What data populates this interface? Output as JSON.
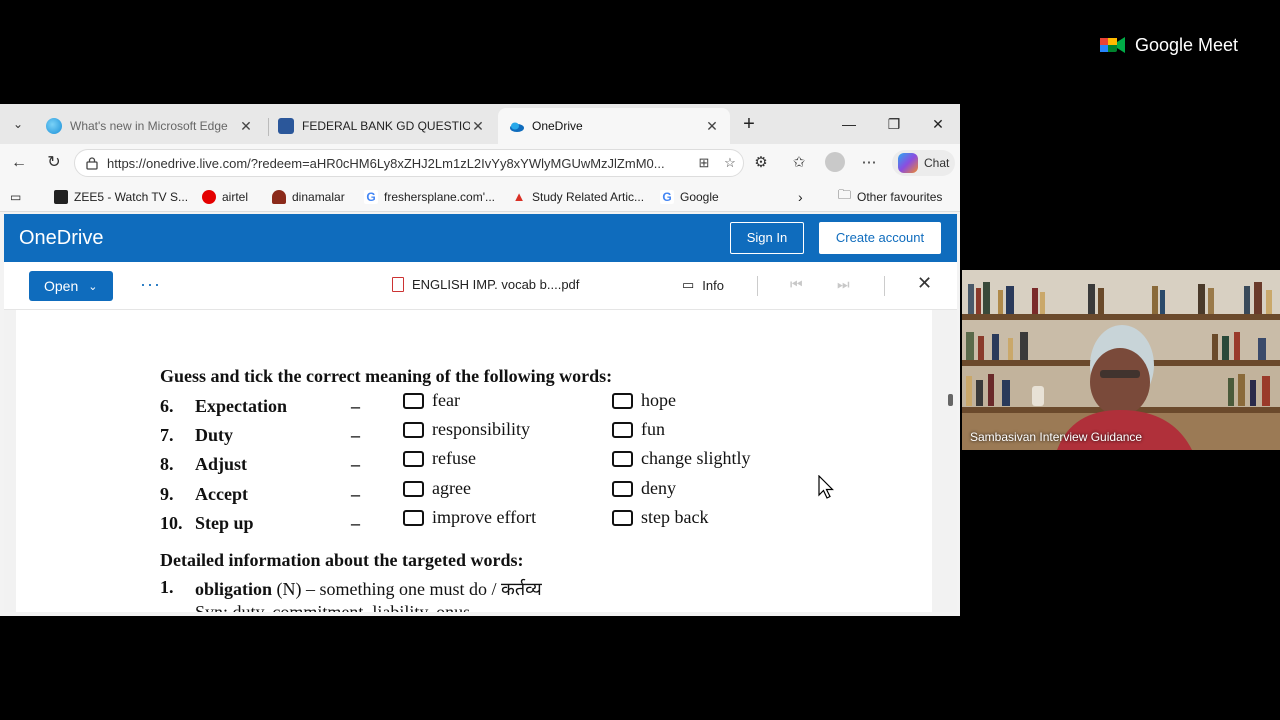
{
  "meet": {
    "brand": "Google Meet"
  },
  "browser": {
    "tabs": [
      {
        "label": "What's new in Microsoft Edge",
        "active": false
      },
      {
        "label": "FEDERAL BANK GD QUESTIONS .d",
        "active": false
      },
      {
        "label": "OneDrive",
        "active": true
      }
    ],
    "url": "https://onedrive.live.com/?redeem=aHR0cHM6Ly8xZHJ2Lm1zL2IvYy8xYWlyMGUwMzJlZmM0...",
    "chat_label": "Chat",
    "favourites": [
      {
        "label": "ZEE5 - Watch TV S...",
        "color": "#222222"
      },
      {
        "label": "airtel",
        "color": "#e40000"
      },
      {
        "label": "dinamalar",
        "color": "#8b2a1a"
      },
      {
        "label": "freshersplane.com'...",
        "color": "#4285f4"
      },
      {
        "label": "Study Related Artic...",
        "color": "#d93025"
      },
      {
        "label": "Google",
        "color": "#4285f4"
      }
    ],
    "other_favourites": "Other favourites"
  },
  "onedrive": {
    "title": "OneDrive",
    "sign_in": "Sign In",
    "create_account": "Create account",
    "open_label": "Open",
    "file_name": "ENGLISH IMP. vocab b....pdf",
    "info_label": "Info",
    "accent": "#0f6cbd"
  },
  "document": {
    "heading": "Guess and tick the correct meaning of the following words:",
    "questions": [
      {
        "num": "6.",
        "word": "Expectation",
        "dash": "–",
        "opt1": "fear",
        "opt2": "hope"
      },
      {
        "num": "7.",
        "word": "Duty",
        "dash": "–",
        "opt1": "responsibility",
        "opt2": "fun"
      },
      {
        "num": "8.",
        "word": "Adjust",
        "dash": "–",
        "opt1": "refuse",
        "opt2": "change slightly"
      },
      {
        "num": "9.",
        "word": "Accept",
        "dash": "–",
        "opt1": "agree",
        "opt2": "deny"
      },
      {
        "num": "10.",
        "word": "Step up",
        "dash": "–",
        "opt1": "improve effort",
        "opt2": "step back"
      }
    ],
    "heading2": "Detailed information about the targeted words:",
    "detail_num": "1.",
    "detail_word": "obligation",
    "detail_rest": " (N) – something one must do / कर्तव्य",
    "detail_syn": "Syn: duty, commitment, liability, onus"
  },
  "participant": {
    "name": "Sambasivan Interview Guidance"
  }
}
